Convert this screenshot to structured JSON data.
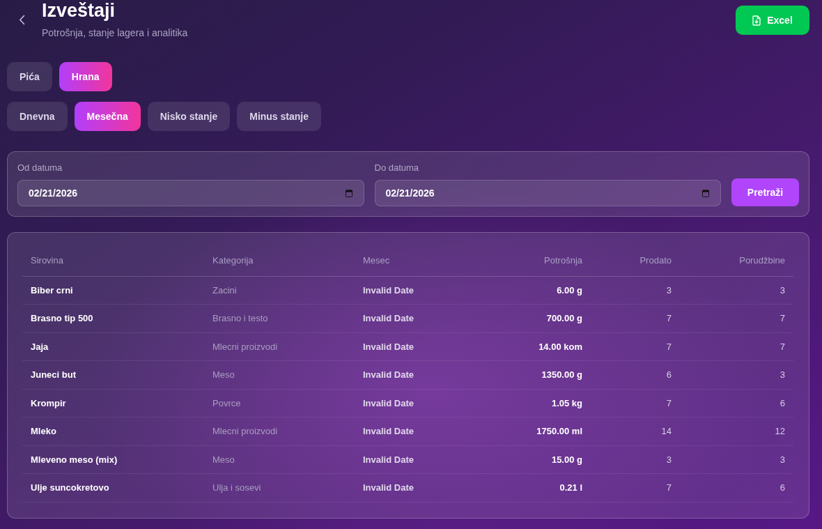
{
  "header": {
    "title": "Izveštaji",
    "subtitle": "Potrošnja, stanje lagera i analitika",
    "export_button": "Excel"
  },
  "category_tabs": [
    {
      "label": "Pića",
      "selected": false
    },
    {
      "label": "Hrana",
      "selected": true
    }
  ],
  "report_tabs": [
    {
      "label": "Dnevna",
      "selected": false
    },
    {
      "label": "Mesečna",
      "selected": true
    },
    {
      "label": "Nisko stanje",
      "selected": false
    },
    {
      "label": "Minus stanje",
      "selected": false
    }
  ],
  "filters": {
    "from": {
      "label": "Od datuma",
      "value": "02/21/2026"
    },
    "to": {
      "label": "Do datuma",
      "value": "02/21/2026"
    },
    "search_button": "Pretraži"
  },
  "table": {
    "columns": [
      "Sirovina",
      "Kategorija",
      "Mesec",
      "Potrošnja",
      "Prodato",
      "Porudžbine"
    ],
    "rows": [
      {
        "name": "Biber crni",
        "category": "Zacini",
        "month": "Invalid Date",
        "consumption": "6.00 g",
        "sold": "3",
        "orders": "3"
      },
      {
        "name": "Brasno tip 500",
        "category": "Brasno i testo",
        "month": "Invalid Date",
        "consumption": "700.00 g",
        "sold": "7",
        "orders": "7"
      },
      {
        "name": "Jaja",
        "category": "Mlecni proizvodi",
        "month": "Invalid Date",
        "consumption": "14.00 kom",
        "sold": "7",
        "orders": "7"
      },
      {
        "name": "Juneci but",
        "category": "Meso",
        "month": "Invalid Date",
        "consumption": "1350.00 g",
        "sold": "6",
        "orders": "3"
      },
      {
        "name": "Krompir",
        "category": "Povrce",
        "month": "Invalid Date",
        "consumption": "1.05 kg",
        "sold": "7",
        "orders": "6"
      },
      {
        "name": "Mleko",
        "category": "Mlecni proizvodi",
        "month": "Invalid Date",
        "consumption": "1750.00 ml",
        "sold": "14",
        "orders": "12"
      },
      {
        "name": "Mleveno meso (mix)",
        "category": "Meso",
        "month": "Invalid Date",
        "consumption": "15.00 g",
        "sold": "3",
        "orders": "3"
      },
      {
        "name": "Ulje suncokretovo",
        "category": "Ulja i sosevi",
        "month": "Invalid Date",
        "consumption": "0.21 l",
        "sold": "7",
        "orders": "6"
      }
    ]
  }
}
